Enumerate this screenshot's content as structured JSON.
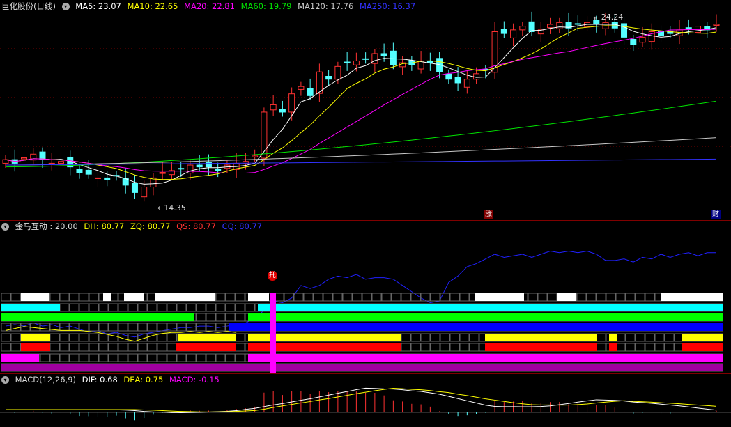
{
  "main_chart": {
    "stock_name": "巨化股份(日线)",
    "ma5": "MA5: 23.07",
    "ma10": "MA10: 22.65",
    "ma20": "MA20: 22.81",
    "ma60": "MA60: 19.79",
    "ma120": "MA120: 17.76",
    "ma250": "MA250: 16.37",
    "high_label": "24.24",
    "low_label": "14.35",
    "tag_zhang": "涨",
    "tag_cai": "财",
    "colors": {
      "up": "#ff3232",
      "down": "#54ffff",
      "ma5": "#ffffff",
      "ma10": "#ffff00",
      "ma20": "#ff00ff",
      "ma60": "#00e600",
      "ma120": "#c8c8c8",
      "ma250": "#3232ff"
    }
  },
  "indicator_panel": {
    "name": "金马互动",
    "value": ": 20.00",
    "dh": "DH: 80.77",
    "zq": "ZQ: 80.77",
    "qs": "QS: 80.77",
    "cq": "CQ: 80.77",
    "signal_tag": "托"
  },
  "macd_panel": {
    "name": "MACD(12,26,9)",
    "dif": "DIF: 0.68",
    "dea": "DEA: 0.75",
    "macd": "MACD: -0.15"
  }
}
